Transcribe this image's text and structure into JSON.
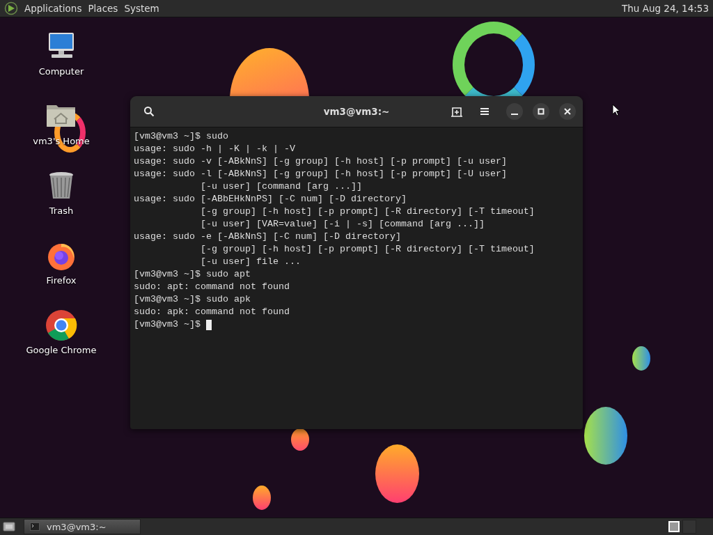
{
  "top_bar": {
    "menus": [
      "Applications",
      "Places",
      "System"
    ],
    "clock": "Thu Aug 24, 14:53"
  },
  "desktop_icons": [
    {
      "kind": "computer",
      "label": "Computer"
    },
    {
      "kind": "home",
      "label": "vm3's Home"
    },
    {
      "kind": "trash",
      "label": "Trash"
    },
    {
      "kind": "firefox",
      "label": "Firefox"
    },
    {
      "kind": "chrome",
      "label": "Google Chrome"
    }
  ],
  "terminal": {
    "title": "vm3@vm3:~",
    "lines": [
      "[vm3@vm3 ~]$ sudo",
      "usage: sudo -h | -K | -k | -V",
      "usage: sudo -v [-ABkNnS] [-g group] [-h host] [-p prompt] [-u user]",
      "usage: sudo -l [-ABkNnS] [-g group] [-h host] [-p prompt] [-U user]",
      "            [-u user] [command [arg ...]]",
      "usage: sudo [-ABbEHkNnPS] [-C num] [-D directory]",
      "            [-g group] [-h host] [-p prompt] [-R directory] [-T timeout]",
      "            [-u user] [VAR=value] [-i | -s] [command [arg ...]]",
      "usage: sudo -e [-ABkNnS] [-C num] [-D directory]",
      "            [-g group] [-h host] [-p prompt] [-R directory] [-T timeout]",
      "            [-u user] file ...",
      "[vm3@vm3 ~]$ sudo apt",
      "sudo: apt: command not found",
      "[vm3@vm3 ~]$ sudo apk",
      "sudo: apk: command not found"
    ],
    "prompt": "[vm3@vm3 ~]$"
  },
  "taskbar": {
    "window_button": "vm3@vm3:~",
    "workspaces": [
      {
        "selected": true
      },
      {
        "selected": false
      }
    ]
  }
}
